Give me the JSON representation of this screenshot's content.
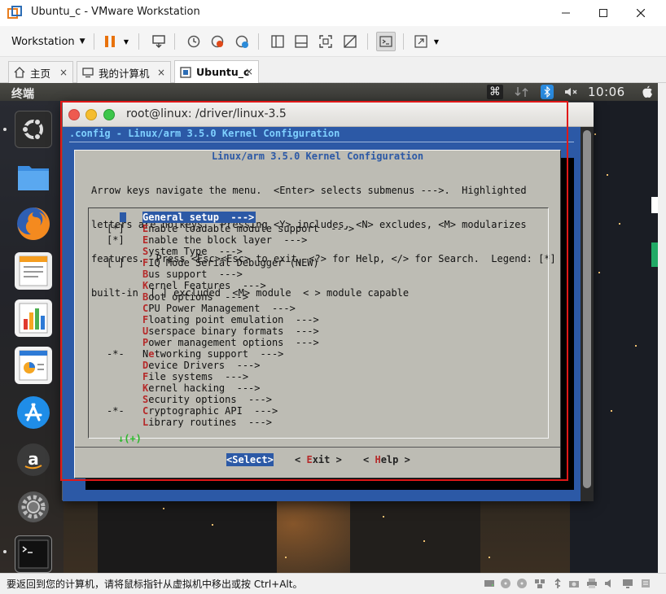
{
  "window": {
    "title": "Ubuntu_c - VMware Workstation",
    "minimize_glyph": "—",
    "maximize_glyph": "☐",
    "close_glyph": "✕"
  },
  "toolbar": {
    "menu_label": "Workstation",
    "menu_arrow": "▼"
  },
  "tabs": [
    {
      "label": "主页",
      "icon": "home-icon"
    },
    {
      "label": "我的计算机",
      "icon": "computer-icon"
    },
    {
      "label": "Ubuntu_c",
      "icon": "vm-icon",
      "active": true
    }
  ],
  "tab_close_glyph": "×",
  "ubuntu_panel": {
    "title": "终端",
    "clock": "10:06"
  },
  "terminal": {
    "title": "root@linux: /driver/linux-3.5"
  },
  "menuconfig": {
    "header": ".config - Linux/arm 3.5.0 Kernel Configuration",
    "dialog_title": "Linux/arm 3.5.0 Kernel Configuration",
    "help_lines": [
      "Arrow keys navigate the menu.  <Enter> selects submenus --->.  Highlighted",
      "letters are hotkeys.  Pressing <Y> includes, <N> excludes, <M> modularizes",
      "features.  Press <Esc><Esc> to exit, <?> for Help, </> for Search.  Legend: [*]",
      "built-in  [ ] excluded  <M> module  < > module capable"
    ],
    "items": [
      {
        "prefix": "",
        "hotkey": "G",
        "rest": "eneral setup  --->",
        "selected": true
      },
      {
        "prefix": "[*]",
        "hotkey": "E",
        "rest": "nable loadable module support  --->"
      },
      {
        "prefix": "[*]",
        "hotkey": "E",
        "rest": "nable the block layer  --->"
      },
      {
        "prefix": "",
        "hotkey": "S",
        "rest": "ystem Type  --->"
      },
      {
        "prefix": "[ ]",
        "hotkey": "F",
        "rest": "IQ Mode Serial Debugger (NEW)"
      },
      {
        "prefix": "",
        "hotkey": "B",
        "rest": "us support  --->"
      },
      {
        "prefix": "",
        "hotkey": "K",
        "rest": "ernel Features  --->"
      },
      {
        "prefix": "",
        "hotkey": "B",
        "rest": "oot options  --->"
      },
      {
        "prefix": "",
        "hotkey": "C",
        "rest": "PU Power Management  --->"
      },
      {
        "prefix": "",
        "hotkey": "F",
        "rest": "loating point emulation  --->"
      },
      {
        "prefix": "",
        "hotkey": "U",
        "rest": "serspace binary formats  --->"
      },
      {
        "prefix": "",
        "hotkey": "P",
        "rest": "ower management options  --->"
      },
      {
        "prefix": "-*-",
        "pre": "N",
        "hotkey": "e",
        "rest": "tworking support  --->"
      },
      {
        "prefix": "",
        "hotkey": "D",
        "rest": "evice Drivers  --->"
      },
      {
        "prefix": "",
        "hotkey": "F",
        "rest": "ile systems  --->"
      },
      {
        "prefix": "",
        "hotkey": "K",
        "rest": "ernel hacking  --->"
      },
      {
        "prefix": "",
        "hotkey": "S",
        "rest": "ecurity options  --->"
      },
      {
        "prefix": "-*-",
        "hotkey": "C",
        "rest": "ryptographic API  --->"
      },
      {
        "prefix": "",
        "hotkey": "L",
        "rest": "ibrary routines  --->"
      }
    ],
    "more_indicator": "↓(+)",
    "buttons": {
      "select": {
        "pre": "<",
        "hotkey": "S",
        "rest": "elect>"
      },
      "exit": {
        "pre": "< ",
        "hotkey": "E",
        "rest": "xit >"
      },
      "help": {
        "pre": "< ",
        "hotkey": "H",
        "rest": "elp >"
      }
    }
  },
  "statusbar": {
    "text": "要返回到您的计算机，请将鼠标指针从虚拟机中移出或按 Ctrl+Alt。"
  }
}
